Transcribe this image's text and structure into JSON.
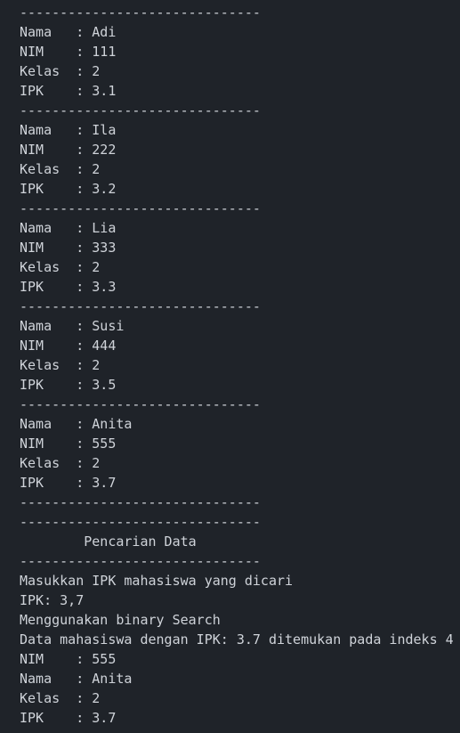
{
  "terminal": {
    "lines": [
      "------------------------------",
      "Nama   : Adi",
      "NIM    : 111",
      "Kelas  : 2",
      "IPK    : 3.1",
      "------------------------------",
      "Nama   : Ila",
      "NIM    : 222",
      "Kelas  : 2",
      "IPK    : 3.2",
      "------------------------------",
      "Nama   : Lia",
      "NIM    : 333",
      "Kelas  : 2",
      "IPK    : 3.3",
      "------------------------------",
      "Nama   : Susi",
      "NIM    : 444",
      "Kelas  : 2",
      "IPK    : 3.5",
      "------------------------------",
      "Nama   : Anita",
      "NIM    : 555",
      "Kelas  : 2",
      "IPK    : 3.7",
      "------------------------------",
      "------------------------------",
      "        Pencarian Data",
      "------------------------------",
      "Masukkan IPK mahasiswa yang dicari",
      "IPK: 3,7",
      "Menggunakan binary Search",
      "Data mahasiswa dengan IPK: 3.7 ditemukan pada indeks 4",
      "NIM    : 555",
      "Nama   : Anita",
      "Kelas  : 2",
      "IPK    : 3.7"
    ]
  }
}
